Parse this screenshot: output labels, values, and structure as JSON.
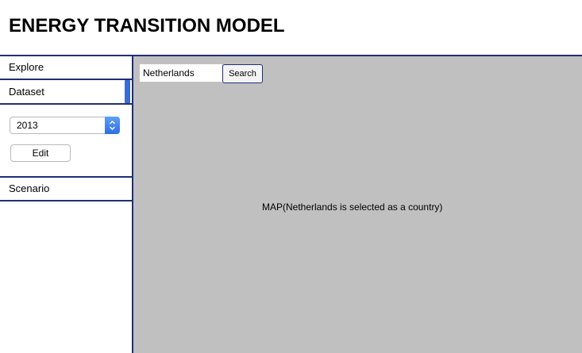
{
  "header": {
    "title": "ENERGY TRANSITION MODEL"
  },
  "sidebar": {
    "explore_label": "Explore",
    "dataset_label": "Dataset",
    "year_select": {
      "selected": "2013"
    },
    "edit_label": "Edit",
    "scenario_label": "Scenario"
  },
  "main": {
    "search": {
      "value": "Netherlands",
      "button_label": "Search"
    },
    "map_placeholder": "MAP(Netherlands is selected as a country)"
  },
  "colors": {
    "accent": "#1f2f7a",
    "map_background": "#c0c0c0",
    "scroll_thumb": "#3b6bd0"
  }
}
